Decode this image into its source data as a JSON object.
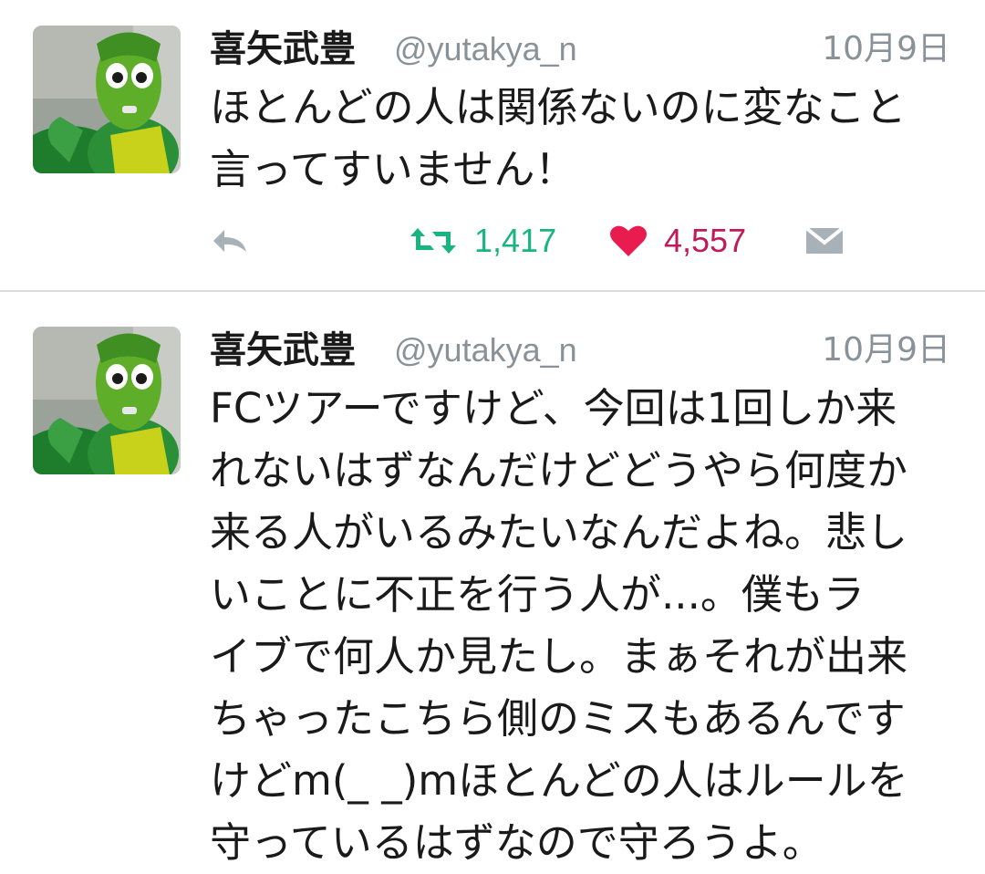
{
  "colors": {
    "retweet_green": "#19b580",
    "like_pink": "#e81c4f",
    "like_count_color": "#c2195a",
    "muted_gray": "#8a9299",
    "icon_gray": "#a9b1b8",
    "divider": "#d9dde1"
  },
  "tweets": [
    {
      "display_name": "喜矢武豊",
      "handle": "@yutakya_n",
      "timestamp": "10月9日",
      "text": "ほとんどの人は関係ないのに変なこと\n言ってすいません！",
      "avatar_icon": "avatar-green-costume",
      "actions": {
        "reply_icon": "reply-icon",
        "retweet_icon": "retweet-icon",
        "retweet_count": "1,417",
        "like_icon": "heart-icon",
        "like_count": "4,557",
        "dm_icon": "envelope-icon"
      }
    },
    {
      "display_name": "喜矢武豊",
      "handle": "@yutakya_n",
      "timestamp": "10月9日",
      "text": "FCツアーですけど、今回は1回しか来\nれないはずなんだけどどうやら何度か\n来る人がいるみたいなんだよね。悲し\nいことに不正を行う人が...。僕もラ\nイブで何人か見たし。まぁそれが出来\nちゃったこちら側のミスもあるんです\nけどm(_ _)mほとんどの人はルールを\n守っているはずなので守ろうよ。",
      "avatar_icon": "avatar-green-costume"
    }
  ]
}
